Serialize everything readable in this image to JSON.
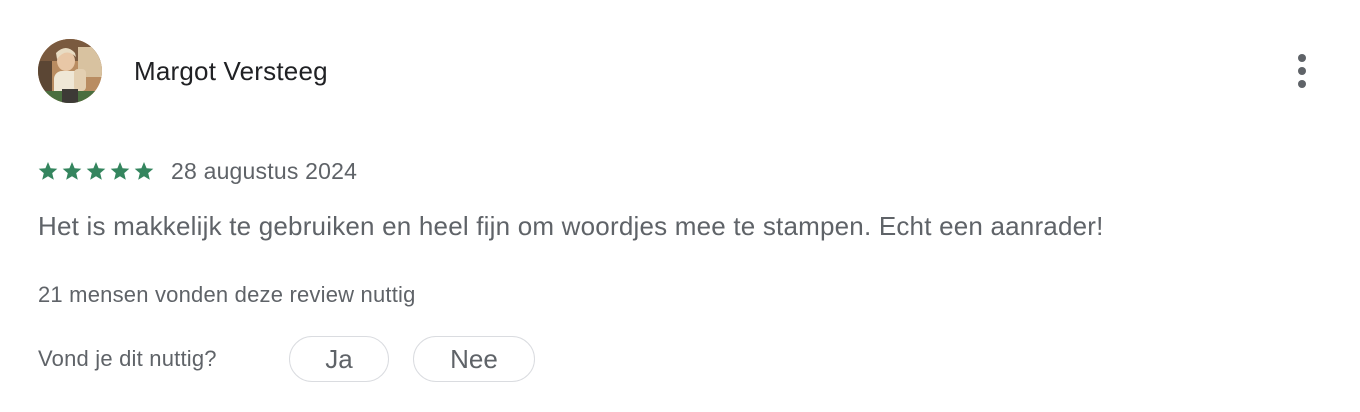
{
  "review": {
    "author": "Margot Versteeg",
    "rating": 5,
    "rating_max": 5,
    "date": "28 augustus 2024",
    "text": "Het is makkelijk te gebruiken en heel fijn om woordjes mee te stampen. Echt een aanrader!",
    "helpful_count_text": "21 mensen vonden deze review nuttig"
  },
  "feedback": {
    "question": "Vond je dit nuttig?",
    "yes_label": "Ja",
    "no_label": "Nee"
  },
  "icons": {
    "more": "more-vert-icon",
    "star": "star-icon"
  },
  "colors": {
    "star": "#34855e",
    "text_primary": "#202124",
    "text_secondary": "#5f6368",
    "pill_border": "#dadce0"
  }
}
